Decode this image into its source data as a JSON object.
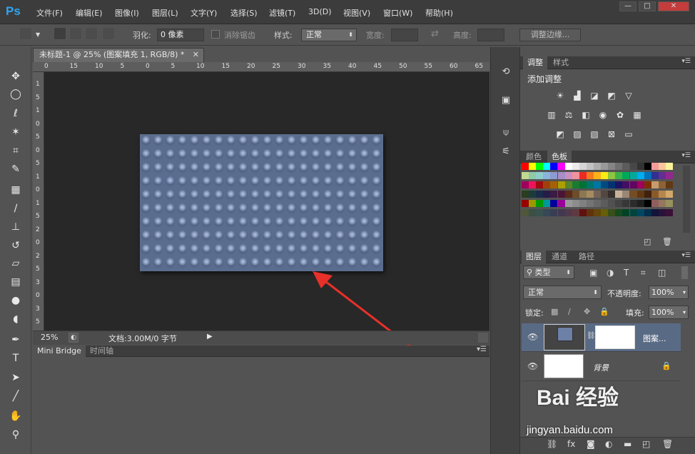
{
  "app": {
    "logo": "Ps"
  },
  "menu": [
    "文件(F)",
    "编辑(E)",
    "图像(I)",
    "图层(L)",
    "文字(Y)",
    "选择(S)",
    "滤镜(T)",
    "3D(D)",
    "视图(V)",
    "窗口(W)",
    "帮助(H)"
  ],
  "window_controls": {
    "minimize": "—",
    "restore": "□",
    "close": "✕"
  },
  "options": {
    "feather_label": "羽化:",
    "feather_value": "0 像素",
    "antialias_label": "消除锯齿",
    "style_label": "样式:",
    "style_value": "正常",
    "width_label": "宽度:",
    "height_label": "高度:",
    "refine_edge": "调整边缘..."
  },
  "document": {
    "tab_title": "未标题-1 @ 25% (图案填充 1, RGB/8) *",
    "zoom": "25%",
    "doc_info": "文档:3.00M/0 字节",
    "ruler_top": [
      "0",
      "15",
      "10",
      "5",
      "0",
      "5",
      "10",
      "15",
      "20",
      "25",
      "30",
      "35",
      "40",
      "45",
      "50",
      "55",
      "60",
      "65"
    ],
    "ruler_left": [
      "1",
      "5",
      "1",
      "0",
      "5",
      "0",
      "5",
      "1",
      "0",
      "1",
      "5",
      "2",
      "0",
      "2",
      "5",
      "3",
      "0",
      "3",
      "5"
    ]
  },
  "bottom_panel": {
    "tabs": [
      "Mini Bridge",
      "时间轴"
    ]
  },
  "adjustments": {
    "tabs": [
      "调整",
      "样式"
    ],
    "title": "添加调整"
  },
  "color_panel": {
    "tabs": [
      "颜色",
      "色板"
    ]
  },
  "swatch_colors": [
    [
      "#ff0000",
      "#ffff00",
      "#00ff00",
      "#00ffff",
      "#0000ff",
      "#ff00ff",
      "#ffffff",
      "#ebebeb",
      "#d6d6d6",
      "#c2c2c2",
      "#adadad",
      "#999999",
      "#858585",
      "#707070",
      "#5c5c5c",
      "#474747",
      "#333333",
      "#000000",
      "#f29c9c",
      "#f7c79c",
      "#fbf29c"
    ],
    [
      "#c2d98f",
      "#8fc9a8",
      "#8ecdc9",
      "#8ab4d9",
      "#8c9bd1",
      "#a88dc9",
      "#c98fc1",
      "#f0929e",
      "#ee2a24",
      "#f47a20",
      "#fbb21a",
      "#ffeb16",
      "#8dc63f",
      "#3cb34a",
      "#00a859",
      "#00a99d",
      "#00aeef",
      "#0072bc",
      "#2e3192",
      "#662d91",
      "#92278f"
    ],
    [
      "#9e005d",
      "#ed145b",
      "#9e0b0f",
      "#a0410d",
      "#a36209",
      "#aba000",
      "#598527",
      "#197b30",
      "#007236",
      "#00746b",
      "#0076a3",
      "#004a80",
      "#003471",
      "#1b1464",
      "#440e62",
      "#630460",
      "#9e005d",
      "#7b2e00",
      "#c69c6d",
      "#8c6239",
      "#603913"
    ],
    [
      "#2a3d1f",
      "#1d3b3b",
      "#1a2c4a",
      "#261c48",
      "#3a1b44",
      "#4a1535",
      "#5a2a1a",
      "#6e4b2a",
      "#8c7853",
      "#a68b60",
      "#736357",
      "#534741",
      "#362f2d",
      "#c7b299",
      "#998675",
      "#754c24",
      "#603913",
      "#42210b",
      "#8a5a2b",
      "#b5874d",
      "#d4a86a"
    ]
  ],
  "layers_panel": {
    "tabs": [
      "图层",
      "通道",
      "路径"
    ],
    "filter_kind": "类型",
    "blend_mode": "正常",
    "opacity_label": "不透明度:",
    "opacity_value": "100%",
    "lock_label": "锁定:",
    "fill_label": "填充:",
    "fill_value": "100%",
    "layers": [
      {
        "name": "图案...",
        "selected": true
      },
      {
        "name": "背景",
        "selected": false
      }
    ]
  },
  "watermark": {
    "brand": "Bai 经验",
    "url": "jingyan.baidu.com"
  },
  "colors": {
    "accent": "#2fa5f0",
    "annotation_arrow": "#e8302a",
    "selected_layer": "#596a84"
  }
}
